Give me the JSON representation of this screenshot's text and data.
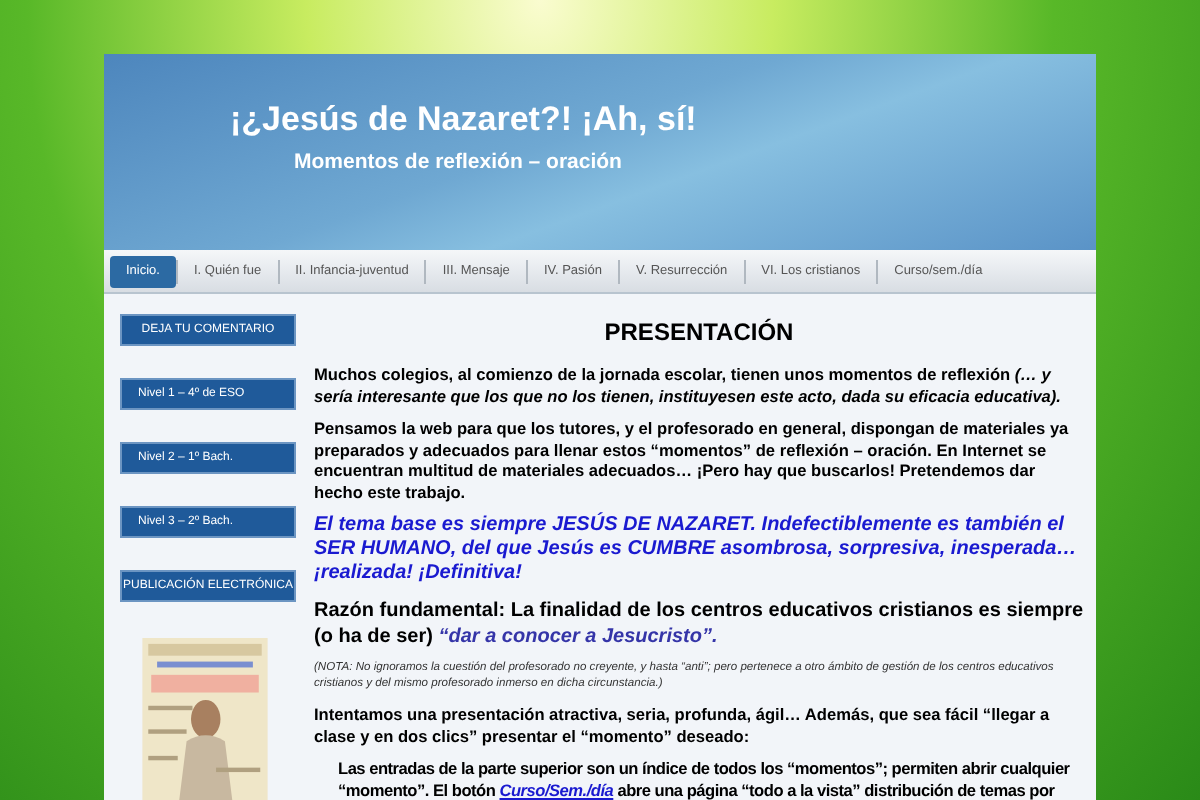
{
  "header": {
    "title": "¡¿Jesús de Nazaret?! ¡Ah, sí!",
    "subtitle": "Momentos de reflexión – oración"
  },
  "nav": [
    {
      "label": "Inicio.",
      "selected": true
    },
    {
      "label": "I. Quién fue",
      "selected": false
    },
    {
      "label": "II. Infancia-juventud",
      "selected": false
    },
    {
      "label": "III. Mensaje",
      "selected": false
    },
    {
      "label": "IV. Pasión",
      "selected": false
    },
    {
      "label": "V. Resurrección",
      "selected": false
    },
    {
      "label": "VI. Los cristianos",
      "selected": false
    },
    {
      "label": "Curso/sem./día",
      "selected": false
    }
  ],
  "sidebar": {
    "buttons": [
      {
        "label": "DEJA TU COMENTARIO",
        "kind": "center"
      },
      {
        "label": "Nivel 1 – 4º de ESO",
        "kind": "left"
      },
      {
        "label": "Nivel 2 – 1º Bach.",
        "kind": "left"
      },
      {
        "label": "Nivel 3 – 2º Bach.",
        "kind": "left"
      },
      {
        "label": "PUBLICACIÓN ELECTRÓNICA",
        "kind": "center"
      }
    ]
  },
  "content": {
    "heading": "PRESENTACIÓN",
    "blocks": [
      {
        "kind": "body",
        "text": "Muchos colegios, al comienzo de la jornada escolar, tienen unos momentos de reflexión *(… y sería interesante que los que no los tienen,  instituyesen este acto, dada su eficacia educativa).*"
      },
      {
        "kind": "body",
        "text": "Pensamos la web para que los tutores, y el profesorado en general, dispongan de materiales ya preparados y adecuados para llenar estos “momentos” de reflexión – oración. En Internet se encuentran multitud de materiales adecuados… ¡Pero hay que buscarlos! Pretendemos dar hecho este trabajo."
      },
      {
        "kind": "emphasis",
        "text": "El tema base es siempre JESÚS DE NAZARET. Indefectiblemente es también el SER HUMANO, del que Jesús es CUMBRE asombrosa, sorpresiva, inesperada… ¡realizada! ¡Definitiva!"
      },
      {
        "kind": "large",
        "text": "Razón fundamental: La finalidad de los centros educativos cristianos es siempre (o ha de ser)",
        "quote": "“dar a conocer a Jesucristo”."
      },
      {
        "kind": "note",
        "text": "(NOTA: No ignoramos la cuestión del profesorado no creyente, y hasta “anti”; pero pertenece a otro ámbito de gestión de los centros educativos cristianos y del mismo profesorado inmerso en dicha circunstancia.)"
      },
      {
        "kind": "body",
        "text": "Intentamos una presentación atractiva, seria, profunda, ágil… Además, que sea fácil “llegar a clase y en dos clics” presentar el “momento” deseado:"
      },
      {
        "kind": "indent",
        "text": "Las entradas de la parte superior son un índice de todos los “momentos”; permiten abrir cualquier “momento”. El botón",
        "link": "Curso/Sem./día",
        "after": "abre una página “todo a la vista” distribución de temas por"
      }
    ]
  }
}
